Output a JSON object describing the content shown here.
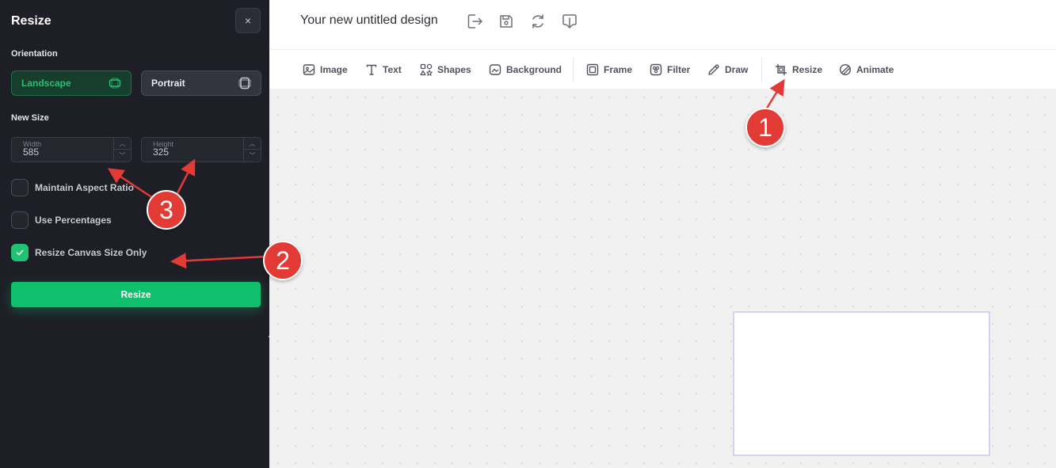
{
  "sidebar": {
    "title": "Resize",
    "close_label": "×",
    "orientation_label": "Orientation",
    "orientation_options": [
      {
        "label": "Landscape",
        "selected": true
      },
      {
        "label": "Portrait",
        "selected": false
      }
    ],
    "new_size_label": "New Size",
    "width": {
      "label": "Width",
      "value": "585"
    },
    "height": {
      "label": "Height",
      "value": "325"
    },
    "options": [
      {
        "label": "Maintain Aspect Ratio",
        "checked": false
      },
      {
        "label": "Use Percentages",
        "checked": false
      },
      {
        "label": "Resize Canvas Size Only",
        "checked": true
      }
    ],
    "resize_button": "Resize"
  },
  "header": {
    "design_title": "Your new untitled design",
    "icons": [
      "export-icon",
      "save-icon",
      "sync-icon",
      "download-icon"
    ]
  },
  "toolbar": {
    "items": [
      {
        "label": "Image",
        "icon": "image-icon"
      },
      {
        "label": "Text",
        "icon": "text-icon"
      },
      {
        "label": "Shapes",
        "icon": "shapes-icon"
      },
      {
        "label": "Background",
        "icon": "background-icon"
      },
      {
        "label": "Frame",
        "icon": "frame-icon"
      },
      {
        "label": "Filter",
        "icon": "filter-icon"
      },
      {
        "label": "Draw",
        "icon": "draw-icon"
      },
      {
        "label": "Resize",
        "icon": "resize-icon"
      },
      {
        "label": "Animate",
        "icon": "animate-icon"
      }
    ]
  },
  "annotations": [
    "1",
    "2",
    "3"
  ],
  "colors": {
    "accent": "#0fbf6c",
    "sidebar_bg": "#1e1f26",
    "annotation": "#e23a34",
    "canvas_border": "#d7d1f2"
  }
}
